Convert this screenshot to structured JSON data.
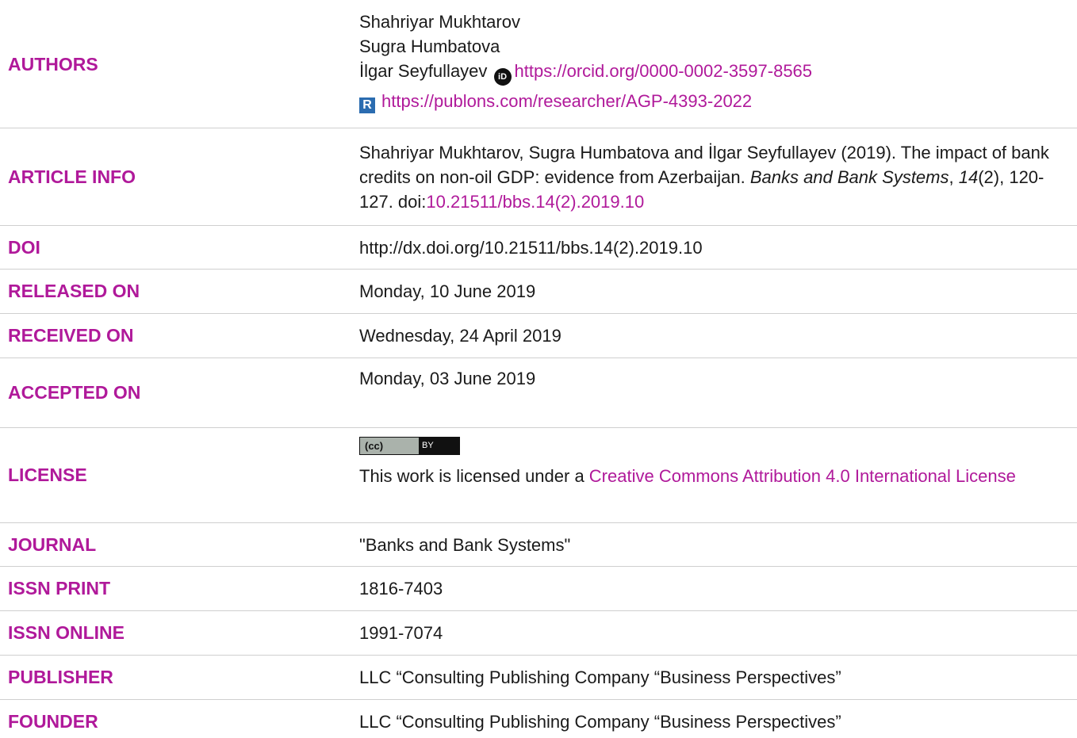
{
  "authors": {
    "label": "AUTHORS",
    "names": [
      "Shahriyar Mukhtarov",
      "Sugra Humbatova",
      "İlgar Seyfullayev"
    ],
    "orcid_url": "https://orcid.org/0000-0002-3597-8565",
    "publons_url": "https://publons.com/researcher/AGP-4393-2022",
    "orcid_icon_text": "iD",
    "publons_icon_text": "R"
  },
  "article_info": {
    "label": "ARTICLE INFO",
    "citation_prefix": "Shahriyar Mukhtarov, Sugra Humbatova and İlgar Seyfullayev (2019). The impact of bank credits on non-oil GDP: evidence from Azerbaijan. ",
    "journal": "Banks and Bank Systems",
    "comma": ", ",
    "volume": "14",
    "pages": "(2), 120-127. doi:",
    "doi_link": "10.21511/bbs.14(2).2019.10"
  },
  "doi": {
    "label": "DOI",
    "value": "http://dx.doi.org/10.21511/bbs.14(2).2019.10"
  },
  "released": {
    "label": "RELEASED ON",
    "value": "Monday, 10 June 2019"
  },
  "received": {
    "label": "RECEIVED ON",
    "value": "Wednesday, 24 April 2019"
  },
  "accepted": {
    "label": "ACCEPTED ON",
    "value": "Monday, 03 June 2019"
  },
  "license": {
    "label": "LICENSE",
    "badge_left": "(cc)",
    "badge_right": "BY",
    "text_prefix": "This work is licensed under a ",
    "link_text": "Creative Commons Attribution 4.0 International License"
  },
  "journal": {
    "label": "JOURNAL",
    "value": "\"Banks and Bank Systems\""
  },
  "issn_print": {
    "label": "ISSN PRINT",
    "value": "1816-7403"
  },
  "issn_online": {
    "label": "ISSN ONLINE",
    "value": "1991-7074"
  },
  "publisher": {
    "label": "PUBLISHER",
    "value": "LLC “Consulting Publishing Company “Business Perspectives”"
  },
  "founder": {
    "label": "FOUNDER",
    "value": "LLC “Consulting Publishing Company “Business Perspectives”"
  },
  "colors": {
    "label": "#b0199a",
    "text": "#1a1a1a",
    "divider": "#cfcfcf"
  }
}
